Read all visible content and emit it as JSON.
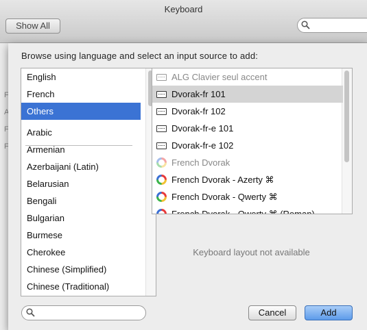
{
  "window": {
    "title": "Keyboard"
  },
  "toolbar": {
    "show_all_label": "Show All",
    "search_icon": "search-icon"
  },
  "sheet": {
    "prompt": "Browse using language and select an input source to add:",
    "languages": [
      {
        "label": "English",
        "selected": false
      },
      {
        "label": "French",
        "selected": false
      },
      {
        "label": "Others",
        "selected": true
      },
      {
        "label": "Arabic",
        "selected": false
      },
      {
        "label": "Armenian",
        "selected": false
      },
      {
        "label": "Azerbaijani (Latin)",
        "selected": false
      },
      {
        "label": "Belarusian",
        "selected": false
      },
      {
        "label": "Bengali",
        "selected": false
      },
      {
        "label": "Bulgarian",
        "selected": false
      },
      {
        "label": "Burmese",
        "selected": false
      },
      {
        "label": "Cherokee",
        "selected": false
      },
      {
        "label": "Chinese (Simplified)",
        "selected": false
      },
      {
        "label": "Chinese (Traditional)",
        "selected": false
      }
    ],
    "sources": [
      {
        "label": "ALG Clavier seul accent",
        "icon": "keyboard-icon",
        "dim": true,
        "selected": false
      },
      {
        "label": "Dvorak-fr 101",
        "icon": "keyboard-icon",
        "dim": false,
        "selected": true
      },
      {
        "label": "Dvorak-fr 102",
        "icon": "keyboard-icon",
        "dim": false,
        "selected": false
      },
      {
        "label": "Dvorak-fr-e 101",
        "icon": "keyboard-icon",
        "dim": false,
        "selected": false
      },
      {
        "label": "Dvorak-fr-e 102",
        "icon": "keyboard-icon",
        "dim": false,
        "selected": false
      },
      {
        "label": "French Dvorak",
        "icon": "dvorak-flag-icon",
        "dim": true,
        "selected": false
      },
      {
        "label": "French Dvorak - Azerty ⌘",
        "icon": "dvorak-flag-icon",
        "dim": false,
        "selected": false
      },
      {
        "label": "French Dvorak - Qwerty ⌘",
        "icon": "dvorak-flag-icon",
        "dim": false,
        "selected": false
      },
      {
        "label": "French Dvorak - Qwerty ⌘ (Roman)",
        "icon": "dvorak-flag-icon",
        "dim": false,
        "selected": false
      }
    ],
    "layout_preview_text": "Keyboard layout not available",
    "search_placeholder": "",
    "cancel_label": "Cancel",
    "add_label": "Add",
    "accent_color": "#3b73d4"
  }
}
